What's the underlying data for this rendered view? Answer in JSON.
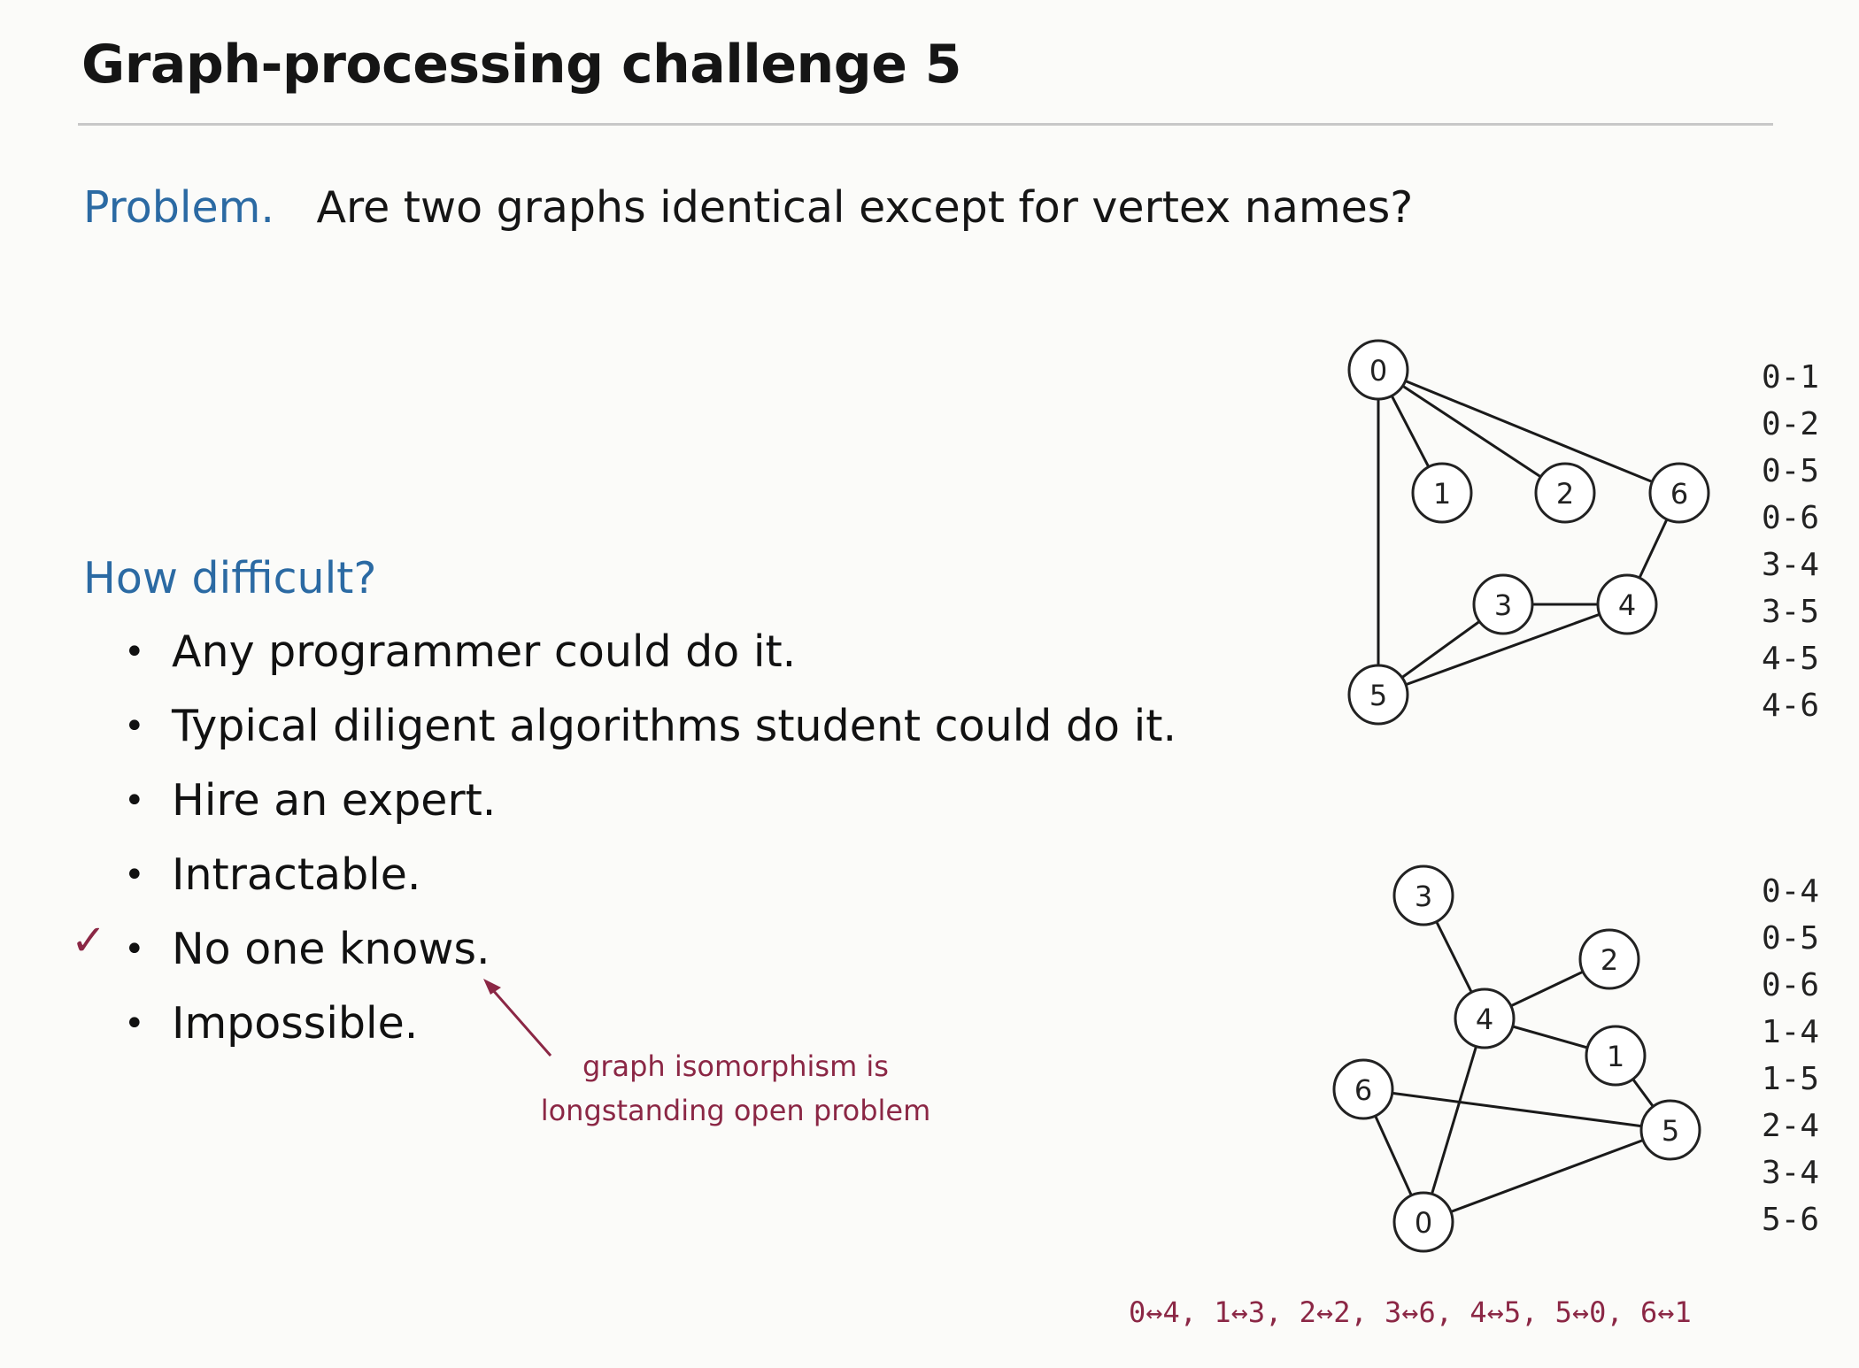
{
  "title": "Graph-processing challenge 5",
  "problem": {
    "label": "Problem.",
    "text": "Are two graphs identical except for vertex names?"
  },
  "difficulty": {
    "heading": "How difficult?",
    "options": [
      "Any programmer could do it.",
      "Typical diligent algorithms student could do it.",
      "Hire an expert.",
      "Intractable.",
      "No one knows.",
      "Impossible."
    ],
    "checked_option": "No one knows.",
    "check_mark": "✓",
    "bullet": "•"
  },
  "annotation": {
    "line1": "graph isomorphism is",
    "line2": "longstanding open problem"
  },
  "graph1": {
    "vertices": [
      "0",
      "1",
      "2",
      "3",
      "4",
      "5",
      "6"
    ],
    "edges": [
      "0-1",
      "0-2",
      "0-5",
      "0-6",
      "3-4",
      "3-5",
      "4-5",
      "4-6"
    ]
  },
  "graph2": {
    "vertices": [
      "0",
      "1",
      "2",
      "3",
      "4",
      "5",
      "6"
    ],
    "edges": [
      "0-4",
      "0-5",
      "0-6",
      "1-4",
      "1-5",
      "2-4",
      "3-4",
      "5-6"
    ]
  },
  "mapping": "0↔4, 1↔3, 2↔2, 3↔6, 4↔5, 5↔0, 6↔1",
  "colors": {
    "heading_blue": "#2b6aa3",
    "annotation_red": "#8b2745",
    "rule": "#c8c8c8"
  }
}
